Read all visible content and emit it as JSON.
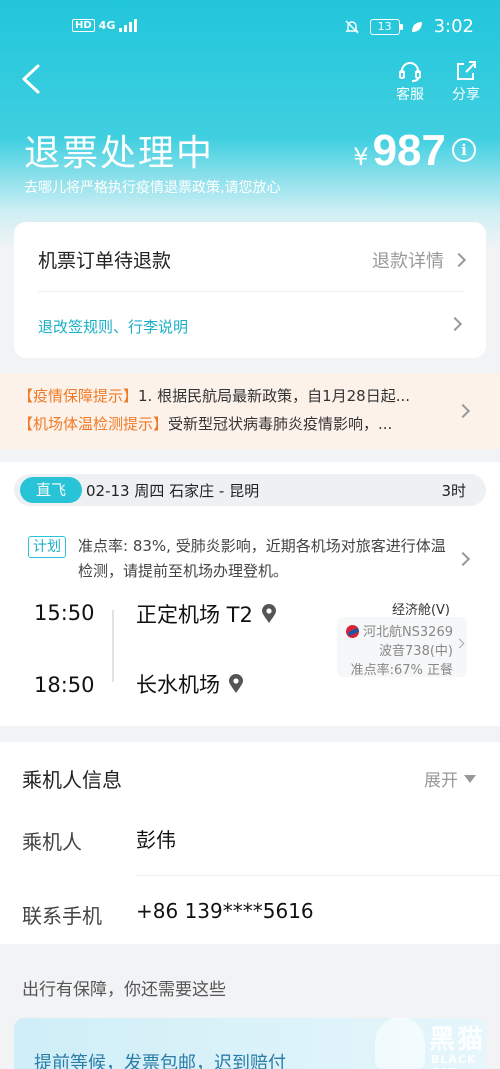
{
  "status_bar": {
    "hd": "HD",
    "network": "4G",
    "battery": "13",
    "time": "3:02"
  },
  "header": {
    "service_label": "客服",
    "share_label": "分享",
    "title": "退票处理中",
    "subtitle": "去哪儿将严格执行疫情退票政策,请您放心",
    "currency": "¥",
    "amount": "987"
  },
  "refund_card": {
    "status": "机票订单待退款",
    "detail_link": "退款详情",
    "rules_link": "退改签规则、行李说明"
  },
  "notices": [
    {
      "tag": "【疫情保障提示】",
      "text": "1. 根据民航局最新政策，自1月28日起..."
    },
    {
      "tag": "【机场体温检测提示】",
      "text": "受新型冠状病毒肺炎疫情影响，..."
    }
  ],
  "flight": {
    "badge": "直飞",
    "date_route": "02-13  周四  石家庄 - 昆明",
    "duration": "3时",
    "plan_tag": "计划",
    "plan_text": "准点率: 83%, 受肺炎影响，近期各机场对旅客进行体温检测，请提前至机场办理登机。",
    "departure_time": "15:50",
    "departure_airport": "正定机场 T2",
    "arrival_time": "18:50",
    "arrival_airport": "长水机场",
    "cabin": "经济舱(V)",
    "carrier": "河北航NS3269",
    "aircraft": "波音738(中)",
    "punctuality": "准点率:67% 正餐"
  },
  "passenger": {
    "section_title": "乘机人信息",
    "expand_label": "展开",
    "name_label": "乘机人",
    "name": "彭伟",
    "phone_label": "联系手机",
    "phone": "+86 139****5616"
  },
  "extras": {
    "guarantee_title": "出行有保障，你还需要这些",
    "promo_text": "提前等候，发票包邮，迟到赔付"
  },
  "watermark": {
    "cn": "黑猫",
    "en": "BLACK CAT"
  }
}
